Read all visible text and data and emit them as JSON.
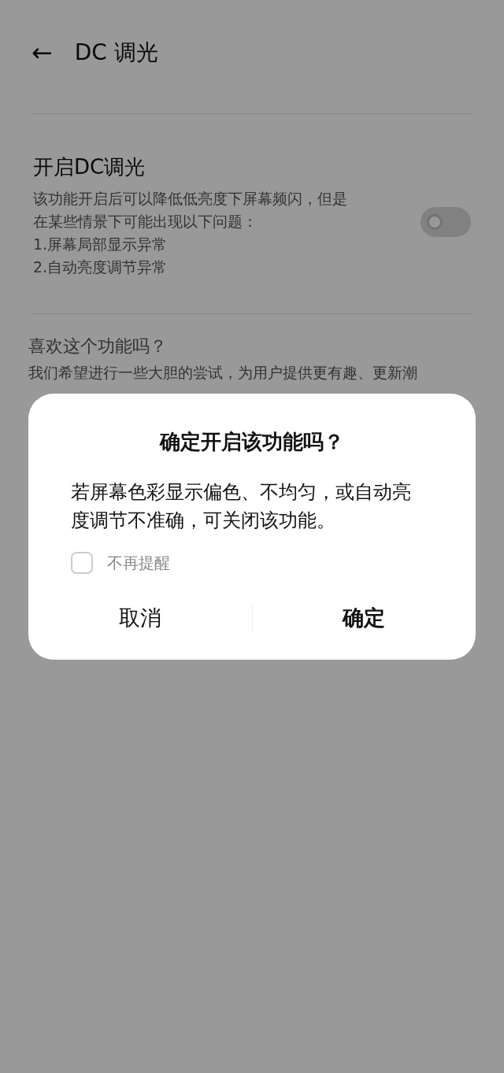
{
  "header": {
    "back_icon": "←",
    "title": "DC 调光"
  },
  "setting": {
    "title": "开启DC调光",
    "description": [
      "该功能开启后可以降低低亮度下屏幕频闪，但是",
      "在某些情景下可能出现以下问题：",
      "1.屏幕局部显示异常",
      "2.自动亮度调节异常"
    ],
    "on": false
  },
  "feedback": {
    "title": "喜欢这个功能吗？",
    "description": [
      "我们希望进行一些大胆的尝试，为用户提供更有趣、更新潮"
    ]
  },
  "dialog": {
    "title": "确定开启该功能吗？",
    "message": "若屏幕色彩显示偏色、不均匀，或自动亮度调节不准确，可关闭该功能。",
    "checkbox": {
      "label": "不再提醒",
      "checked": false
    },
    "buttons": [
      {
        "label": "取消",
        "kind": "cancel"
      },
      {
        "label": "确定",
        "kind": "confirm"
      }
    ]
  }
}
